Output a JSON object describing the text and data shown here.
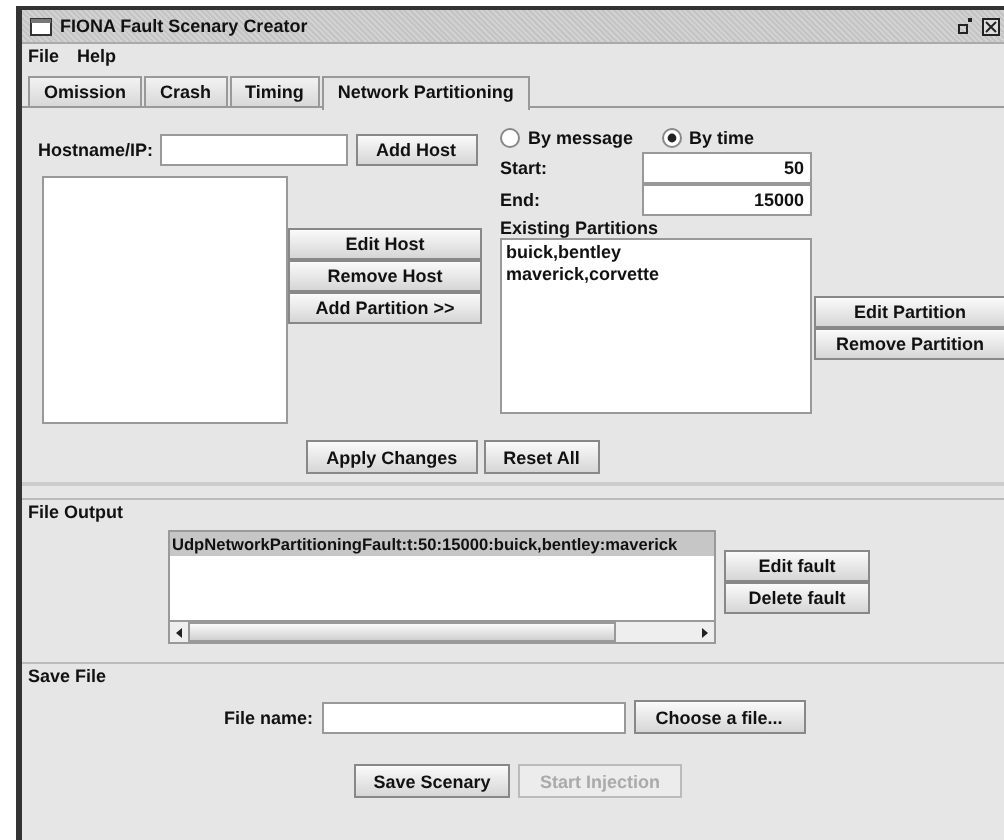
{
  "window": {
    "title": "FIONA Fault Scenary Creator"
  },
  "menu": [
    "File",
    "Help"
  ],
  "tabs": [
    {
      "label": "Omission",
      "selected": false
    },
    {
      "label": "Crash",
      "selected": false
    },
    {
      "label": "Timing",
      "selected": false
    },
    {
      "label": "Network Partitioning",
      "selected": true
    }
  ],
  "hosts": {
    "label": "Hostname/IP:",
    "add_button": "Add Host",
    "buttons": [
      "Edit Host",
      "Remove Host",
      "Add Partition >>"
    ]
  },
  "mode": [
    {
      "label": "By message",
      "selected": false
    },
    {
      "label": "By time",
      "selected": true
    }
  ],
  "range": [
    {
      "label": "Start:",
      "value": "50"
    },
    {
      "label": "End:",
      "value": "15000"
    }
  ],
  "partitions": {
    "label": "Existing Partitions",
    "items": [
      "buick,bentley",
      "maverick,corvette"
    ],
    "buttons": [
      "Edit Partition",
      "Remove Partition"
    ]
  },
  "actions": [
    "Apply Changes",
    "Reset All"
  ],
  "file_output": {
    "title": "File Output",
    "items": [
      {
        "text": "UdpNetworkPartitioningFault:t:50:15000:buick,bentley:maverick",
        "selected": true
      }
    ],
    "buttons": [
      "Edit fault",
      "Delete fault"
    ]
  },
  "save_file": {
    "title": "Save File",
    "label": "File name:",
    "choose_button": "Choose a file...",
    "buttons": [
      {
        "label": "Save Scenary",
        "disabled": false
      },
      {
        "label": "Start Injection",
        "disabled": true
      }
    ]
  }
}
